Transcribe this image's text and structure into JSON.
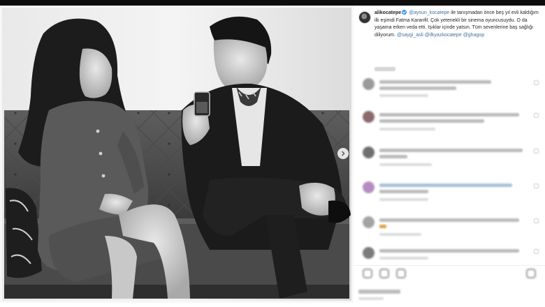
{
  "post": {
    "username": "alikocatepe",
    "verified": true,
    "caption_mention_1": "@aysun_kocatepe",
    "caption_part_1": " ile tanışmadan önce beş yıl evli kaldığım ilk eşimdi Fatma Karanfil. Çok yetenekli bir sinema oyuncusuydu. O da yaşama erken veda etti. Işıklar içinde yatsın. Tüm sevenlerine baş sağlığı diliyorum. ",
    "caption_mention_2": "@saygi_asli",
    "caption_mention_3": "@ilkyazkocatepe",
    "caption_mention_4": "@ghagop",
    "photo_description_icon": "black-and-white-photo",
    "next_icon": "chevron-right-icon"
  },
  "colors": {
    "mention": "#3f729b",
    "text": "#262626",
    "verified": "#3897f0"
  }
}
